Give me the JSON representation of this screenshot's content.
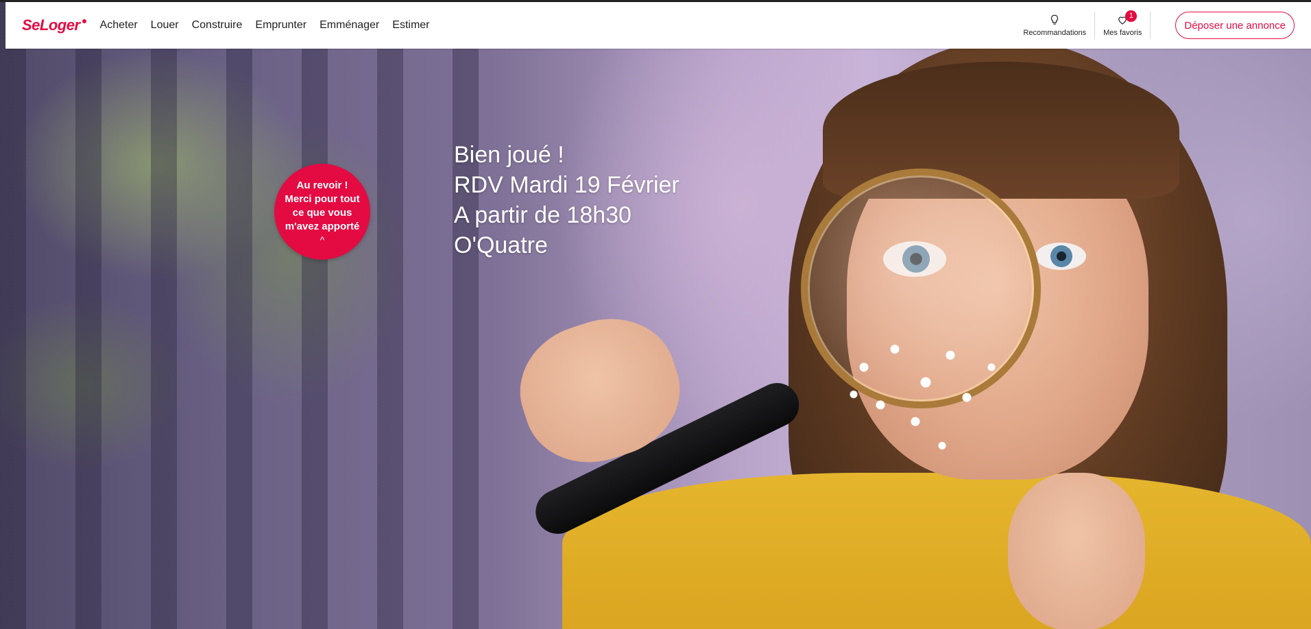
{
  "brand": {
    "logo_text": "SeLoger",
    "accent_color": "#e30b42"
  },
  "nav": {
    "items": [
      {
        "label": "Acheter"
      },
      {
        "label": "Louer"
      },
      {
        "label": "Construire"
      },
      {
        "label": "Emprunter"
      },
      {
        "label": "Emménager"
      },
      {
        "label": "Estimer"
      }
    ]
  },
  "header_tools": {
    "recommendations": {
      "label": "Recommandations",
      "icon": "lightbulb-icon"
    },
    "favorites": {
      "label": "Mes favoris",
      "icon": "heart-icon",
      "badge": "1"
    }
  },
  "cta": {
    "deposit_label": "Déposer une annonce"
  },
  "bubble": {
    "text": "Au revoir ! Merci pour tout ce que vous m'avez apporté",
    "caret": "^"
  },
  "hero": {
    "lines": [
      "Bien joué !",
      "RDV Mardi 19 Février",
      "A partir de 18h30",
      "O'Quatre"
    ]
  }
}
